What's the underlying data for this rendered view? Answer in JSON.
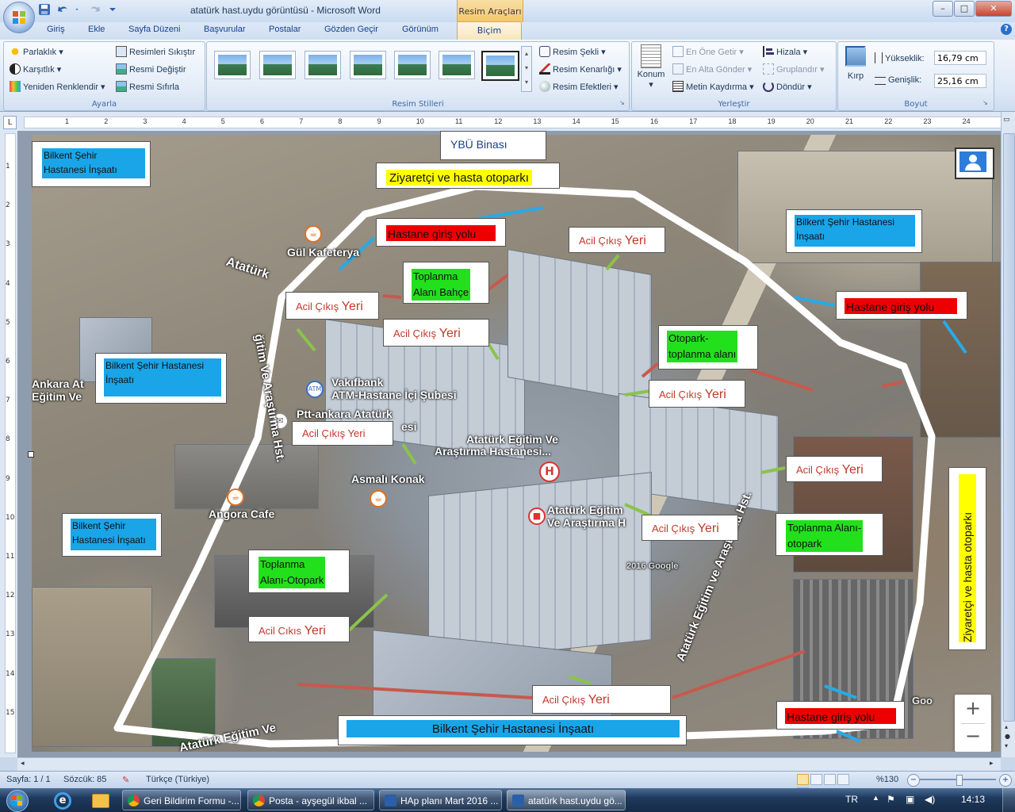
{
  "window": {
    "title": "atatürk hast.uydu görüntüsü - Microsoft Word",
    "context_tab": "Resim Araçları",
    "buttons": {
      "min": "–",
      "max": "□",
      "close": "✕"
    },
    "help": "?"
  },
  "tabs": [
    "Giriş",
    "Ekle",
    "Sayfa Düzeni",
    "Başvurular",
    "Postalar",
    "Gözden Geçir",
    "Görünüm",
    "Biçim"
  ],
  "ribbon": {
    "ayarla": {
      "label": "Ayarla",
      "parlaklik": "Parlaklık",
      "karsitlik": "Karşıtlık",
      "yeniden": "Yeniden Renklendir",
      "sikistir": "Resimleri Sıkıştır",
      "degistir": "Resmi Değiştir",
      "sifirla": "Resmi Sıfırla"
    },
    "stiller": {
      "label": "Resim Stilleri",
      "sekli": "Resim Şekli",
      "kenarligi": "Resim Kenarlığı",
      "efektleri": "Resim Efektleri"
    },
    "yerlestir": {
      "label": "Yerleştir",
      "konum": "Konum",
      "one": "En Öne Getir",
      "alta": "En Alta Gönder",
      "kaydirma": "Metin Kaydırma",
      "hizala": "Hizala",
      "grupla": "Gruplandır",
      "dondur": "Döndür"
    },
    "boyut": {
      "label": "Boyut",
      "kirp": "Kırp",
      "yukseklik_label": "Yükseklik:",
      "yukseklik": "16,79 cm",
      "genislik_label": "Genişlik:",
      "genislik": "25,16 cm"
    }
  },
  "ruler": {
    "marks": [
      "1",
      "2",
      "3",
      "4",
      "5",
      "6",
      "7",
      "8",
      "9",
      "10",
      "11",
      "12",
      "13",
      "14",
      "15",
      "16",
      "17",
      "18",
      "19",
      "20",
      "21",
      "22",
      "23",
      "24"
    ],
    "vmarks": [
      "1",
      "2",
      "3",
      "4",
      "5",
      "6",
      "7",
      "8",
      "9",
      "10",
      "11",
      "12",
      "13",
      "14",
      "15"
    ]
  },
  "map": {
    "labels": {
      "gul": "Gül Kafeterya",
      "ataturk_cd": "Atatürk",
      "vakif1": "Vakıfbank",
      "vakif2": "ATM-Hastane İçi Şubesi",
      "ptt1": "Ptt-ankara Atatürk",
      "ptt2": "esi",
      "hast1": "Atatürk Eğitim Ve",
      "hast2": "Araştırma Hastanesi...",
      "asmali": "Asmalı Konak",
      "angora": "Angora Cafe",
      "ankara1": "Ankara At",
      "ankara2": "Eğitim Ve",
      "hast3": "Atatürk Eğitim",
      "hast4": "Ve Araştırma H",
      "road_bottom": "Atatürk Eğitim ve Araştırma Hst.",
      "road_left": "ğitim Ve Araştırma Hst.",
      "road_bl": "Atatürk Eğitim Ve",
      "google": "2016 Google",
      "goog": "Goo",
      "atm": "ATM",
      "h": "H"
    },
    "boxes": {
      "ybu": "YBÜ Binası",
      "ziyaretci_top": "Ziyaretçi ve hasta otoparkı",
      "bilkent_tl1": "Bilkent Şehir",
      "bilkent_tl2": "Hastanesi İnşaatı",
      "bilkent_tr1": "Bilkent Şehir Hastanesi",
      "bilkent_tr2": "İnşaatı",
      "bilkent_ml1": "Bilkent Şehir Hastanesi",
      "bilkent_ml2": "İnşaatı",
      "bilkent_bl1": "Bilkent Şehir",
      "bilkent_bl2": "Hastanesi İnşaatı",
      "bilkent_bottom": "Bilkent Şehir Hastanesi İnşaatı",
      "giris_top": "Hastane giriş yolu",
      "giris_right": "Hastane giriş yolu",
      "giris_bottom": "Hastane giriş yolu",
      "toplanma_bahce1": "Toplanma",
      "toplanma_bahce2": "Alanı Bahçe",
      "otopark_toplanma1": "Otopark-",
      "otopark_toplanma2": "toplanma alanı",
      "toplanma_otopark_l1": "Toplanma",
      "toplanma_otopark_l2": "Alanı-Otopark",
      "toplanma_otopark_r1": "Toplanma Alanı-",
      "toplanma_otopark_r2": "otopark",
      "ziyaretci_right": "Ziyaretçi ve hasta otoparkı",
      "acil_a": "Acil Çıkış ",
      "acil_b": "Yeri",
      "acil_c": "Acil Çıkış Yeri"
    }
  },
  "statusbar": {
    "sayfa": "Sayfa: 1 / 1",
    "sozcuk": "Sözcük: 85",
    "dil": "Türkçe (Türkiye)",
    "zoom": "%130"
  },
  "taskbar": {
    "items": [
      "Geri Bildirim Formu -...",
      "Posta - ayşegül ikbal ...",
      "HAp planı Mart 2016 ...",
      "atatürk hast.uydu gö..."
    ],
    "lang": "TR",
    "time": "14:13"
  },
  "colors": {
    "accent": "#19a5e8",
    "red": "#ef0000",
    "green": "#22e01c",
    "yellow": "#ffff00",
    "white_outline": "#ffffff"
  }
}
